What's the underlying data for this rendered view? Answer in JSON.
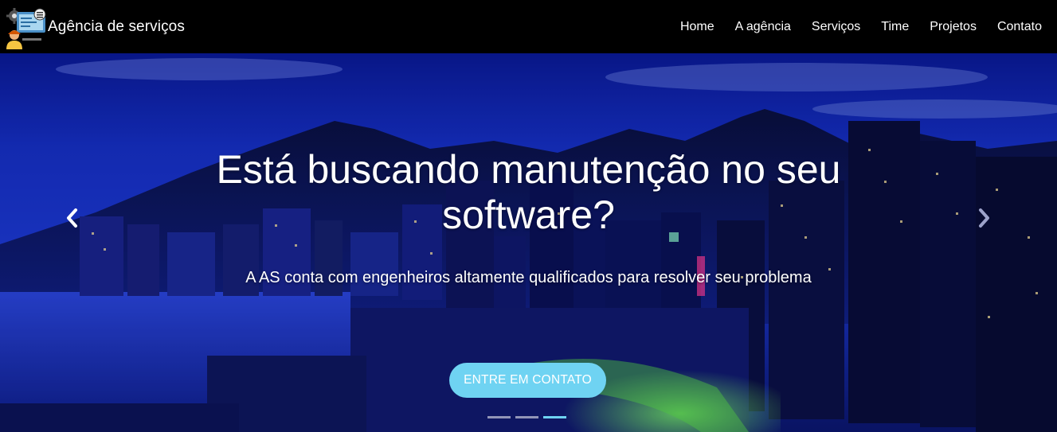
{
  "brand": {
    "name": "Agência de serviços",
    "logo_icon": "service-agency-logo-icon"
  },
  "nav": {
    "items": [
      {
        "label": "Home"
      },
      {
        "label": "A agência"
      },
      {
        "label": "Serviços"
      },
      {
        "label": "Time"
      },
      {
        "label": "Projetos"
      },
      {
        "label": "Contato"
      }
    ]
  },
  "hero": {
    "title": "Está buscando manutenção no seu software?",
    "subtitle": "A AS conta com engenheiros altamente qualificados para resolver seu problema",
    "cta_label": "ENTRE EM CONTATO",
    "prev_icon": "chevron-left-icon",
    "next_icon": "chevron-right-icon",
    "slide_count": 3,
    "active_slide": 3
  },
  "colors": {
    "navbar_bg": "#000000",
    "accent": "#6fd3f2",
    "text": "#ffffff"
  }
}
